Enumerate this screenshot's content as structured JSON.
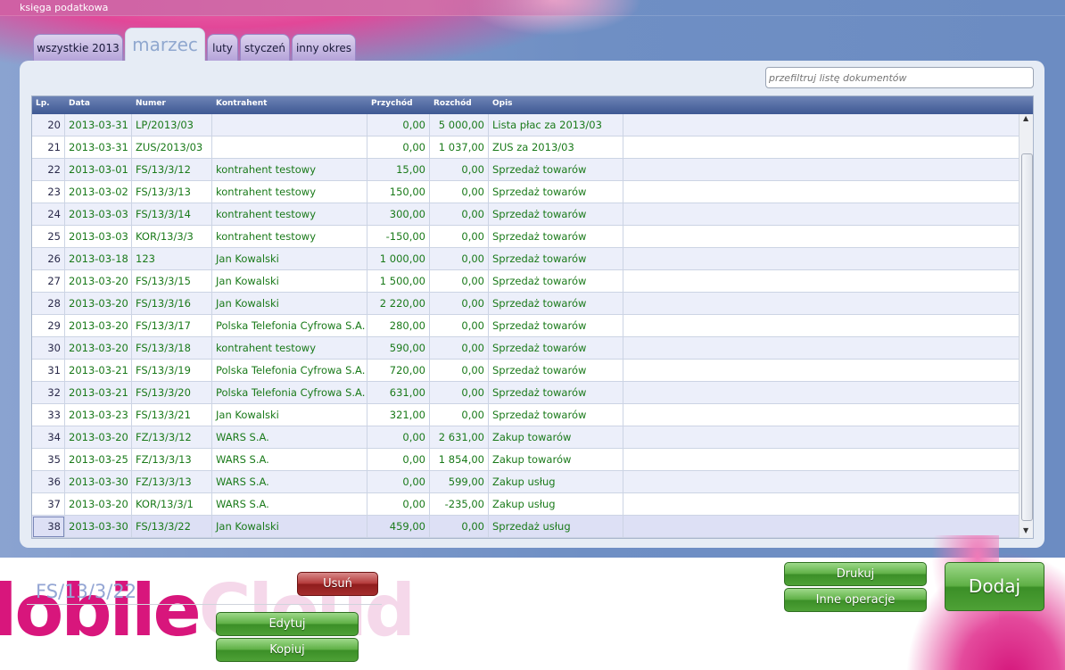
{
  "window": {
    "title": "księga podatkowa"
  },
  "tabs": [
    {
      "label": "wszystkie 2013"
    },
    {
      "label": "marzec"
    },
    {
      "label": "luty"
    },
    {
      "label": "styczeń"
    },
    {
      "label": "inny okres"
    }
  ],
  "filter": {
    "placeholder": "przefiltruj listę dokumentów"
  },
  "table": {
    "columns": [
      "Lp.",
      "Data",
      "Numer",
      "Kontrahent",
      "Przychód",
      "Rozchód",
      "Opis"
    ],
    "rows": [
      {
        "lp": "20",
        "data": "2013-03-31",
        "numer": "LP/2013/03",
        "kontrahent": "",
        "przychod": "0,00",
        "rozchod": "5 000,00",
        "opis": "Lista płac za 2013/03"
      },
      {
        "lp": "21",
        "data": "2013-03-31",
        "numer": "ZUS/2013/03",
        "kontrahent": "",
        "przychod": "0,00",
        "rozchod": "1 037,00",
        "opis": "ZUS za 2013/03"
      },
      {
        "lp": "22",
        "data": "2013-03-01",
        "numer": "FS/13/3/12",
        "kontrahent": "kontrahent testowy",
        "przychod": "15,00",
        "rozchod": "0,00",
        "opis": "Sprzedaż towarów"
      },
      {
        "lp": "23",
        "data": "2013-03-02",
        "numer": "FS/13/3/13",
        "kontrahent": "kontrahent testowy",
        "przychod": "150,00",
        "rozchod": "0,00",
        "opis": "Sprzedaż towarów"
      },
      {
        "lp": "24",
        "data": "2013-03-03",
        "numer": "FS/13/3/14",
        "kontrahent": "kontrahent testowy",
        "przychod": "300,00",
        "rozchod": "0,00",
        "opis": "Sprzedaż towarów"
      },
      {
        "lp": "25",
        "data": "2013-03-03",
        "numer": "KOR/13/3/3",
        "kontrahent": "kontrahent testowy",
        "przychod": "-150,00",
        "rozchod": "0,00",
        "opis": "Sprzedaż towarów"
      },
      {
        "lp": "26",
        "data": "2013-03-18",
        "numer": "123",
        "kontrahent": "Jan Kowalski",
        "przychod": "1 000,00",
        "rozchod": "0,00",
        "opis": "Sprzedaż towarów"
      },
      {
        "lp": "27",
        "data": "2013-03-20",
        "numer": "FS/13/3/15",
        "kontrahent": "Jan Kowalski",
        "przychod": "1 500,00",
        "rozchod": "0,00",
        "opis": "Sprzedaż towarów"
      },
      {
        "lp": "28",
        "data": "2013-03-20",
        "numer": "FS/13/3/16",
        "kontrahent": "Jan Kowalski",
        "przychod": "2 220,00",
        "rozchod": "0,00",
        "opis": "Sprzedaż towarów"
      },
      {
        "lp": "29",
        "data": "2013-03-20",
        "numer": "FS/13/3/17",
        "kontrahent": "Polska Telefonia Cyfrowa S.A.",
        "przychod": "280,00",
        "rozchod": "0,00",
        "opis": "Sprzedaż towarów"
      },
      {
        "lp": "30",
        "data": "2013-03-20",
        "numer": "FS/13/3/18",
        "kontrahent": "kontrahent testowy",
        "przychod": "590,00",
        "rozchod": "0,00",
        "opis": "Sprzedaż towarów"
      },
      {
        "lp": "31",
        "data": "2013-03-21",
        "numer": "FS/13/3/19",
        "kontrahent": "Polska Telefonia Cyfrowa S.A.",
        "przychod": "720,00",
        "rozchod": "0,00",
        "opis": "Sprzedaż towarów"
      },
      {
        "lp": "32",
        "data": "2013-03-21",
        "numer": "FS/13/3/20",
        "kontrahent": "Polska Telefonia Cyfrowa S.A.",
        "przychod": "631,00",
        "rozchod": "0,00",
        "opis": "Sprzedaż towarów"
      },
      {
        "lp": "33",
        "data": "2013-03-23",
        "numer": "FS/13/3/21",
        "kontrahent": "Jan Kowalski",
        "przychod": "321,00",
        "rozchod": "0,00",
        "opis": "Sprzedaż towarów"
      },
      {
        "lp": "34",
        "data": "2013-03-20",
        "numer": "FZ/13/3/12",
        "kontrahent": "WARS S.A.",
        "przychod": "0,00",
        "rozchod": "2 631,00",
        "opis": "Zakup towarów"
      },
      {
        "lp": "35",
        "data": "2013-03-25",
        "numer": "FZ/13/3/13",
        "kontrahent": "WARS S.A.",
        "przychod": "0,00",
        "rozchod": "1 854,00",
        "opis": "Zakup towarów"
      },
      {
        "lp": "36",
        "data": "2013-03-30",
        "numer": "FZ/13/3/13",
        "kontrahent": "WARS S.A.",
        "przychod": "0,00",
        "rozchod": "599,00",
        "opis": "Zakup usług"
      },
      {
        "lp": "37",
        "data": "2013-03-20",
        "numer": "KOR/13/3/1",
        "kontrahent": "WARS S.A.",
        "przychod": "0,00",
        "rozchod": "-235,00",
        "opis": "Zakup usług"
      },
      {
        "lp": "38",
        "data": "2013-03-30",
        "numer": "FS/13/3/22",
        "kontrahent": "Jan Kowalski",
        "przychod": "459,00",
        "rozchod": "0,00",
        "opis": "Sprzedaż usług"
      }
    ]
  },
  "details": {
    "document": "FS/13/3/22"
  },
  "buttons": {
    "delete": "Usuń",
    "edit": "Edytuj",
    "copy": "Kopiuj",
    "print": "Drukuj",
    "other": "Inne operacje",
    "add": "Dodaj"
  },
  "brand": {
    "part1": "lobile",
    "part2": "Cloud"
  },
  "colors": {
    "row_text": "#1a7a1a",
    "header": "#3e5893",
    "accent": "#d8167c"
  }
}
